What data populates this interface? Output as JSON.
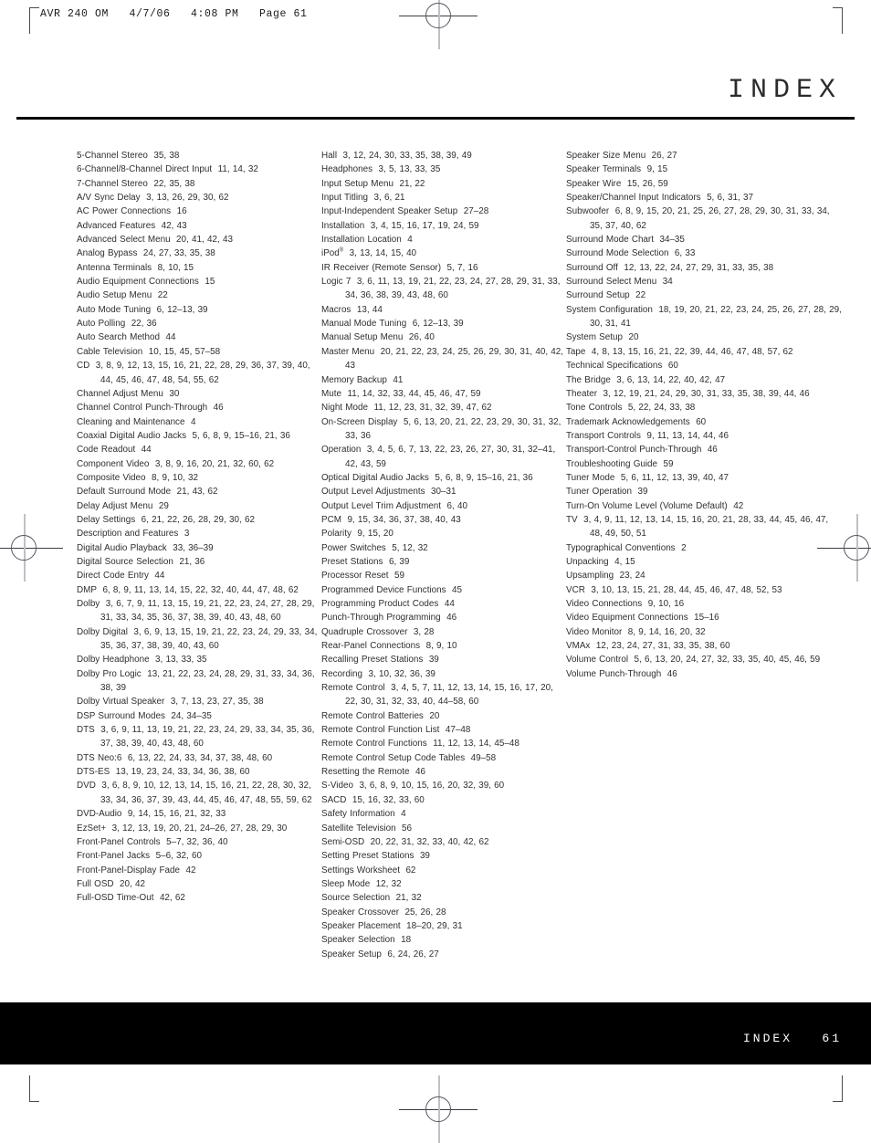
{
  "running_header": "AVR 240 OM   4/7/06   4:08 PM   Page 61",
  "page_title": "INDEX",
  "footer": {
    "label": "INDEX",
    "page_number": "61",
    "text": "INDEX   61"
  },
  "colors": {
    "text": "#2f2f2f",
    "rule": "#000000",
    "footer_band": "#000000",
    "footer_text": "#ffffff"
  },
  "index": {
    "columns": [
      {
        "entries": [
          {
            "term": "5-Channel Stereo",
            "pages": "35, 38"
          },
          {
            "term": "6-Channel/8-Channel Direct Input",
            "pages": "11, 14, 32"
          },
          {
            "term": "7-Channel Stereo",
            "pages": "22, 35, 38"
          },
          {
            "term": "A/V Sync Delay",
            "pages": "3, 13, 26, 29, 30, 62"
          },
          {
            "term": "AC Power Connections",
            "pages": "16"
          },
          {
            "term": "Advanced Features",
            "pages": "42, 43"
          },
          {
            "term": "Advanced Select Menu",
            "pages": "20, 41, 42, 43"
          },
          {
            "term": "Analog Bypass",
            "pages": "24, 27, 33, 35, 38"
          },
          {
            "term": "Antenna Terminals",
            "pages": "8, 10, 15"
          },
          {
            "term": "Audio Equipment Connections",
            "pages": "15"
          },
          {
            "term": "Audio Setup Menu",
            "pages": "22"
          },
          {
            "term": "Auto Mode Tuning",
            "pages": "6, 12–13, 39"
          },
          {
            "term": "Auto Polling",
            "pages": "22, 36"
          },
          {
            "term": "Auto Search Method",
            "pages": "44"
          },
          {
            "term": "Cable Television",
            "pages": "10, 15, 45, 57–58"
          },
          {
            "term": "CD",
            "pages": "3, 8, 9, 12, 13, 15, 16, 21, 22, 28, 29, 36, 37, 39, 40, 44, 45, 46, 47, 48, 54, 55, 62"
          },
          {
            "term": "Channel Adjust Menu",
            "pages": "30"
          },
          {
            "term": "Channel Control Punch-Through",
            "pages": "46"
          },
          {
            "term": "Cleaning and Maintenance",
            "pages": "4"
          },
          {
            "term": "Coaxial Digital Audio Jacks",
            "pages": "5, 6, 8, 9, 15–16, 21, 36"
          },
          {
            "term": "Code Readout",
            "pages": "44"
          },
          {
            "term": "Component Video",
            "pages": "3, 8, 9, 16, 20, 21, 32, 60, 62"
          },
          {
            "term": "Composite Video",
            "pages": "8, 9, 10, 32"
          },
          {
            "term": "Default Surround Mode",
            "pages": "21, 43, 62"
          },
          {
            "term": "Delay Adjust Menu",
            "pages": "29"
          },
          {
            "term": "Delay Settings",
            "pages": "6, 21, 22, 26, 28, 29, 30, 62"
          },
          {
            "term": "Description and Features",
            "pages": "3"
          },
          {
            "term": "Digital Audio Playback",
            "pages": "33, 36–39"
          },
          {
            "term": "Digital Source Selection",
            "pages": "21, 36"
          },
          {
            "term": "Direct Code Entry",
            "pages": "44"
          },
          {
            "term": "DMP",
            "pages": "6, 8, 9, 11, 13, 14, 15, 22, 32, 40, 44, 47, 48, 62"
          },
          {
            "term": "Dolby",
            "pages": "3, 6, 7, 9, 11, 13, 15, 19, 21, 22, 23, 24, 27, 28, 29, 31, 33, 34, 35, 36, 37, 38, 39, 40, 43, 48, 60"
          },
          {
            "term": "Dolby Digital",
            "pages": "3, 6, 9, 13, 15, 19, 21, 22, 23, 24, 29, 33, 34, 35, 36, 37, 38, 39, 40, 43, 60"
          },
          {
            "term": "Dolby Headphone",
            "pages": "3, 13, 33, 35"
          },
          {
            "term": "Dolby Pro Logic",
            "pages": "13, 21, 22, 23, 24, 28, 29, 31, 33, 34, 36, 38, 39"
          },
          {
            "term": "Dolby Virtual Speaker",
            "pages": "3, 7, 13, 23, 27, 35, 38"
          },
          {
            "term": "DSP Surround Modes",
            "pages": "24, 34–35"
          },
          {
            "term": "DTS",
            "pages": "3, 6, 9, 11, 13, 19, 21, 22, 23, 24, 29, 33, 34, 35, 36, 37, 38, 39, 40, 43, 48, 60"
          },
          {
            "term": "DTS Neo:6",
            "pages": "6, 13, 22, 24, 33, 34, 37, 38, 48, 60"
          },
          {
            "term": "DTS-ES",
            "pages": "13, 19, 23, 24, 33, 34, 36, 38, 60"
          },
          {
            "term": "DVD",
            "pages": "3, 6, 8, 9, 10, 12, 13, 14, 15, 16, 21, 22, 28, 30, 32, 33, 34, 36, 37, 39, 43, 44, 45, 46, 47, 48, 55, 59, 62"
          },
          {
            "term": "DVD-Audio",
            "pages": "9, 14, 15, 16, 21, 32, 33"
          },
          {
            "term": "EzSet+",
            "pages": "3, 12, 13, 19, 20, 21, 24–26, 27, 28, 29, 30"
          },
          {
            "term": "Front-Panel Controls",
            "pages": "5–7, 32, 36, 40"
          },
          {
            "term": "Front-Panel Jacks",
            "pages": "5–6, 32, 60"
          },
          {
            "term": "Front-Panel-Display Fade",
            "pages": "42"
          },
          {
            "term": "Full OSD",
            "pages": "20, 42"
          },
          {
            "term": "Full-OSD Time-Out",
            "pages": "42, 62"
          }
        ]
      },
      {
        "entries": [
          {
            "term": "Hall",
            "pages": "3, 12, 24, 30, 33, 35, 38, 39, 49"
          },
          {
            "term": "Headphones",
            "pages": "3, 5, 13, 33, 35"
          },
          {
            "term": "Input Setup Menu",
            "pages": "21, 22"
          },
          {
            "term": "Input Titling",
            "pages": "3, 6, 21"
          },
          {
            "term": "Input-Independent Speaker Setup",
            "pages": "27–28"
          },
          {
            "term": "Installation",
            "pages": "3, 4, 15, 16, 17, 19, 24, 59"
          },
          {
            "term": "Installation Location",
            "pages": "4"
          },
          {
            "term": "iPod",
            "superscript": "®",
            "pages": "3, 13, 14, 15, 40"
          },
          {
            "term": "IR Receiver (Remote Sensor)",
            "pages": "5, 7, 16"
          },
          {
            "term": "Logic 7",
            "pages": "3, 6, 11, 13, 19, 21, 22, 23, 24, 27, 28, 29, 31, 33, 34, 36, 38, 39, 43, 48, 60"
          },
          {
            "term": "Macros",
            "pages": "13, 44"
          },
          {
            "term": "Manual Mode Tuning",
            "pages": "6, 12–13, 39"
          },
          {
            "term": "Manual Setup Menu",
            "pages": "26, 40"
          },
          {
            "term": "Master Menu",
            "pages": "20, 21, 22, 23, 24, 25, 26, 29, 30, 31, 40, 42, 43"
          },
          {
            "term": "Memory Backup",
            "pages": "41"
          },
          {
            "term": "Mute",
            "pages": "11, 14, 32, 33, 44, 45, 46, 47, 59"
          },
          {
            "term": "Night Mode",
            "pages": "11, 12, 23, 31, 32, 39, 47, 62"
          },
          {
            "term": "On-Screen Display",
            "pages": "5, 6, 13, 20, 21, 22, 23, 29, 30, 31, 32, 33, 36"
          },
          {
            "term": "Operation",
            "pages": "3, 4, 5, 6, 7, 13, 22, 23, 26, 27, 30, 31, 32–41, 42, 43, 59"
          },
          {
            "term": "Optical Digital Audio Jacks",
            "pages": "5, 6, 8, 9, 15–16, 21, 36"
          },
          {
            "term": "Output Level Adjustments",
            "pages": "30–31"
          },
          {
            "term": "Output Level Trim Adjustment",
            "pages": "6, 40"
          },
          {
            "term": "PCM",
            "pages": "9, 15, 34, 36, 37, 38, 40, 43"
          },
          {
            "term": "Polarity",
            "pages": "9, 15, 20"
          },
          {
            "term": "Power Switches",
            "pages": "5, 12, 32"
          },
          {
            "term": "Preset Stations",
            "pages": "6, 39"
          },
          {
            "term": "Processor Reset",
            "pages": "59"
          },
          {
            "term": "Programmed Device Functions",
            "pages": "45"
          },
          {
            "term": "Programming Product Codes",
            "pages": "44"
          },
          {
            "term": "Punch-Through Programming",
            "pages": "46"
          },
          {
            "term": "Quadruple Crossover",
            "pages": "3, 28"
          },
          {
            "term": "Rear-Panel Connections",
            "pages": "8, 9, 10"
          },
          {
            "term": "Recalling Preset Stations",
            "pages": "39"
          },
          {
            "term": "Recording",
            "pages": "3, 10, 32, 36, 39"
          },
          {
            "term": "Remote Control",
            "pages": "3, 4, 5, 7, 11, 12, 13, 14, 15, 16, 17, 20, 22, 30, 31, 32, 33, 40, 44–58, 60"
          },
          {
            "term": "Remote Control Batteries",
            "pages": "20"
          },
          {
            "term": "Remote Control Function List",
            "pages": "47–48"
          },
          {
            "term": "Remote Control Functions",
            "pages": "11, 12, 13, 14, 45–48"
          },
          {
            "term": "Remote Control Setup Code Tables",
            "pages": "49–58"
          },
          {
            "term": "Resetting the Remote",
            "pages": "46"
          },
          {
            "term": "S-Video",
            "pages": "3, 6, 8, 9, 10, 15, 16, 20, 32, 39, 60"
          },
          {
            "term": "SACD",
            "pages": "15, 16, 32, 33, 60"
          },
          {
            "term": "Safety Information",
            "pages": "4"
          },
          {
            "term": "Satellite Television",
            "pages": "56"
          },
          {
            "term": "Semi-OSD",
            "pages": "20, 22, 31, 32, 33, 40, 42, 62"
          },
          {
            "term": "Setting Preset Stations",
            "pages": "39"
          },
          {
            "term": "Settings Worksheet",
            "pages": "62"
          },
          {
            "term": "Sleep Mode",
            "pages": "12, 32"
          },
          {
            "term": "Source Selection",
            "pages": "21, 32"
          },
          {
            "term": "Speaker Crossover",
            "pages": "25, 26, 28"
          },
          {
            "term": "Speaker Placement",
            "pages": "18–20, 29, 31"
          },
          {
            "term": "Speaker Selection",
            "pages": "18"
          },
          {
            "term": "Speaker Setup",
            "pages": "6, 24, 26, 27"
          }
        ]
      },
      {
        "entries": [
          {
            "term": "Speaker Size Menu",
            "pages": "26, 27"
          },
          {
            "term": "Speaker Terminals",
            "pages": "9, 15"
          },
          {
            "term": "Speaker Wire",
            "pages": "15, 26, 59"
          },
          {
            "term": "Speaker/Channel Input Indicators",
            "pages": "5, 6, 31, 37"
          },
          {
            "term": "Subwoofer",
            "pages": "6, 8, 9, 15, 20, 21, 25, 26, 27, 28, 29, 30, 31, 33, 34, 35, 37, 40, 62"
          },
          {
            "term": "Surround Mode Chart",
            "pages": "34–35"
          },
          {
            "term": "Surround Mode Selection",
            "pages": "6, 33"
          },
          {
            "term": "Surround Off",
            "pages": "12, 13, 22, 24, 27, 29, 31, 33, 35, 38"
          },
          {
            "term": "Surround Select Menu",
            "pages": "34"
          },
          {
            "term": "Surround Setup",
            "pages": "22"
          },
          {
            "term": "System Configuration",
            "pages": "18, 19, 20, 21, 22, 23, 24, 25, 26, 27, 28, 29, 30, 31, 41"
          },
          {
            "term": "System Setup",
            "pages": "20"
          },
          {
            "term": "Tape",
            "pages": "4, 8, 13, 15, 16, 21, 22, 39, 44, 46, 47, 48, 57, 62"
          },
          {
            "term": "Technical Specifications",
            "pages": "60"
          },
          {
            "term": "The Bridge",
            "pages": "3, 6, 13, 14, 22, 40, 42, 47"
          },
          {
            "term": "Theater",
            "pages": "3, 12, 19, 21, 24, 29, 30, 31, 33, 35, 38, 39, 44, 46"
          },
          {
            "term": "Tone Controls",
            "pages": "5, 22, 24, 33, 38"
          },
          {
            "term": "Trademark Acknowledgements",
            "pages": "60"
          },
          {
            "term": "Transport Controls",
            "pages": "9, 11, 13, 14, 44, 46"
          },
          {
            "term": "Transport-Control Punch-Through",
            "pages": "46"
          },
          {
            "term": "Troubleshooting Guide",
            "pages": "59"
          },
          {
            "term": "Tuner Mode",
            "pages": "5, 6, 11, 12, 13, 39, 40, 47"
          },
          {
            "term": "Tuner Operation",
            "pages": "39"
          },
          {
            "term": "Turn-On Volume Level (Volume Default)",
            "pages": "42"
          },
          {
            "term": "TV",
            "pages": "3, 4, 9, 11, 12, 13, 14, 15, 16, 20, 21, 28, 33, 44, 45, 46, 47, 48, 49, 50, 51"
          },
          {
            "term": "Typographical Conventions",
            "pages": "2"
          },
          {
            "term": "Unpacking",
            "pages": "4, 15"
          },
          {
            "term": "Upsampling",
            "pages": "23, 24"
          },
          {
            "term": "VCR",
            "pages": "3, 10, 13, 15, 21, 28, 44, 45, 46, 47, 48, 52, 53"
          },
          {
            "term": "Video Connections",
            "pages": "9, 10, 16"
          },
          {
            "term": "Video Equipment Connections",
            "pages": "15–16"
          },
          {
            "term": "Video Monitor",
            "pages": "8, 9, 14, 16, 20, 32"
          },
          {
            "term": "VMAx",
            "pages": "12, 23, 24, 27, 31, 33, 35, 38, 60"
          },
          {
            "term": "Volume Control",
            "pages": "5, 6, 13, 20, 24, 27, 32, 33, 35, 40, 45, 46, 59"
          },
          {
            "term": "Volume Punch-Through",
            "pages": "46"
          }
        ]
      }
    ]
  }
}
